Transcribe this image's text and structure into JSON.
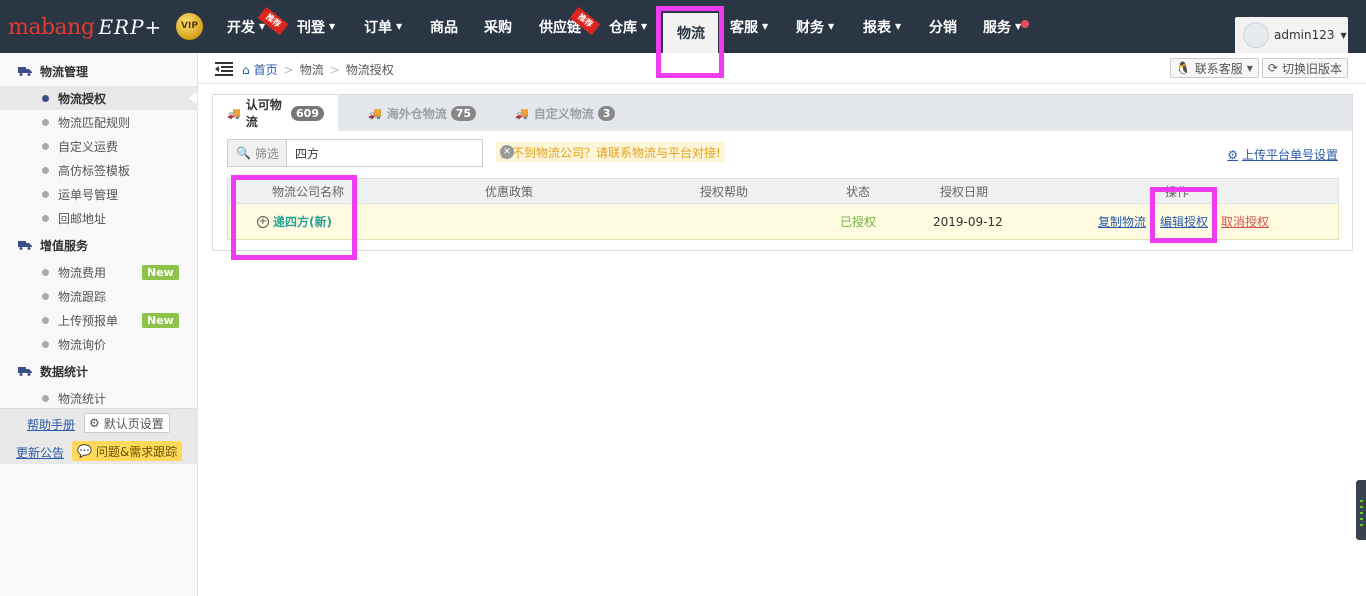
{
  "brand": {
    "logo_text": "mabang",
    "logo_suffix": "ERP+",
    "vip": "VIP"
  },
  "nav": {
    "items": [
      {
        "label": "开发",
        "caret": true,
        "ribbon": "推荐"
      },
      {
        "label": "刊登",
        "caret": true
      },
      {
        "label": "订单",
        "caret": true
      },
      {
        "label": "商品",
        "caret": false
      },
      {
        "label": "采购",
        "caret": false
      },
      {
        "label": "供应链",
        "caret": false,
        "ribbon": "推荐"
      },
      {
        "label": "仓库",
        "caret": true
      },
      {
        "label": "物流",
        "caret": false,
        "active": true
      },
      {
        "label": "客服",
        "caret": true
      },
      {
        "label": "财务",
        "caret": true
      },
      {
        "label": "报表",
        "caret": true
      },
      {
        "label": "分销",
        "caret": false
      },
      {
        "label": "服务",
        "caret": true,
        "dot": true
      }
    ],
    "user": "admin123"
  },
  "sidebar": {
    "groups": [
      {
        "title": "物流管理",
        "items": [
          {
            "label": "物流授权",
            "active": true
          },
          {
            "label": "物流匹配规则"
          },
          {
            "label": "自定义运费"
          },
          {
            "label": "高仿标签模板"
          },
          {
            "label": "运单号管理"
          },
          {
            "label": "回邮地址"
          }
        ]
      },
      {
        "title": "增值服务",
        "items": [
          {
            "label": "物流费用",
            "tag": "New"
          },
          {
            "label": "物流跟踪"
          },
          {
            "label": "上传预报单",
            "tag": "New"
          },
          {
            "label": "物流询价"
          }
        ]
      },
      {
        "title": "数据统计",
        "items": [
          {
            "label": "物流统计"
          }
        ]
      }
    ],
    "footer": {
      "help": "帮助手册",
      "default_page": "默认页设置",
      "updates": "更新公告",
      "issues": "问题&需求跟踪"
    }
  },
  "breadcrumb": {
    "home": "首页",
    "level1": "物流",
    "level2": "物流授权"
  },
  "topbuttons": {
    "contact": "联系客服",
    "switch_old": "切换旧版本"
  },
  "tabs": [
    {
      "label": "认可物流",
      "count": "609",
      "active": true
    },
    {
      "label": "海外仓物流",
      "count": "75"
    },
    {
      "label": "自定义物流",
      "count": "3"
    }
  ],
  "filter": {
    "label": "筛选",
    "value": "四方"
  },
  "notice": "找不到物流公司？请联系物流与平台对接!",
  "upload_link": "上传平台单号设置",
  "table": {
    "headers": [
      "物流公司名称",
      "优惠政策",
      "授权帮助",
      "状态",
      "授权日期",
      "操作"
    ],
    "rows": [
      {
        "company": "递四方(新)",
        "policy": "",
        "help": "",
        "status": "已授权",
        "date": "2019-09-12",
        "actions": [
          "复制物流",
          "编辑授权",
          "取消授权"
        ]
      }
    ]
  },
  "colors": {
    "navbar": "#2b3645",
    "highlight": "#f03cf0",
    "link": "#2c5ba8",
    "status_ok": "#73b342",
    "cancel": "#d9534f"
  }
}
